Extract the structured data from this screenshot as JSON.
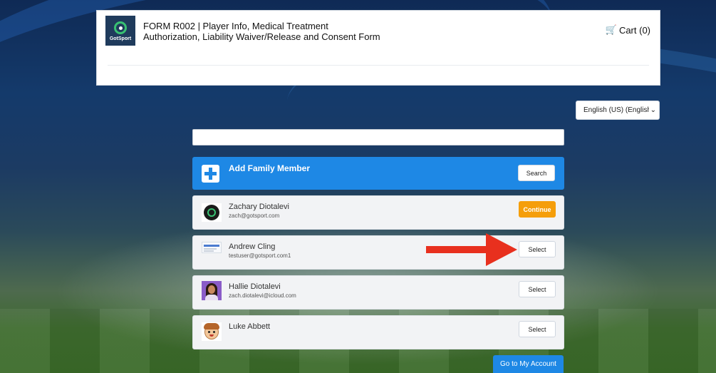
{
  "header": {
    "logo_text": "GotSport",
    "form_title_line1": "FORM R002 | Player Info, Medical Treatment",
    "form_title_line2": "Authorization, Liability Waiver/Release and Consent Form",
    "cart_label": "Cart (0)"
  },
  "language": {
    "selected": "English (US) (English)"
  },
  "search": {
    "value": "",
    "placeholder": ""
  },
  "add_member": {
    "label": "Add Family Member",
    "button": "Search"
  },
  "members": [
    {
      "name": "Zachary Diotalevi",
      "email": "zach@gotsport.com",
      "button": "Continue",
      "avatar": "gotsport-logo-avatar"
    },
    {
      "name": "Andrew Cling",
      "email": "testuser@gotsport.com1",
      "button": "Select",
      "avatar": "document-thumbnail-avatar"
    },
    {
      "name": "Hallie Diotalevi",
      "email": "zach.diotalevi@icloud.com",
      "button": "Select",
      "avatar": "woman-photo-avatar"
    },
    {
      "name": "Luke Abbett",
      "email": "",
      "button": "Select",
      "avatar": "cartoon-boy-avatar"
    }
  ],
  "footer": {
    "account_button": "Go to My Account"
  },
  "colors": {
    "primary_blue": "#1e88e5",
    "continue_orange": "#f59e0b",
    "annotation_arrow": "#e8301e"
  }
}
